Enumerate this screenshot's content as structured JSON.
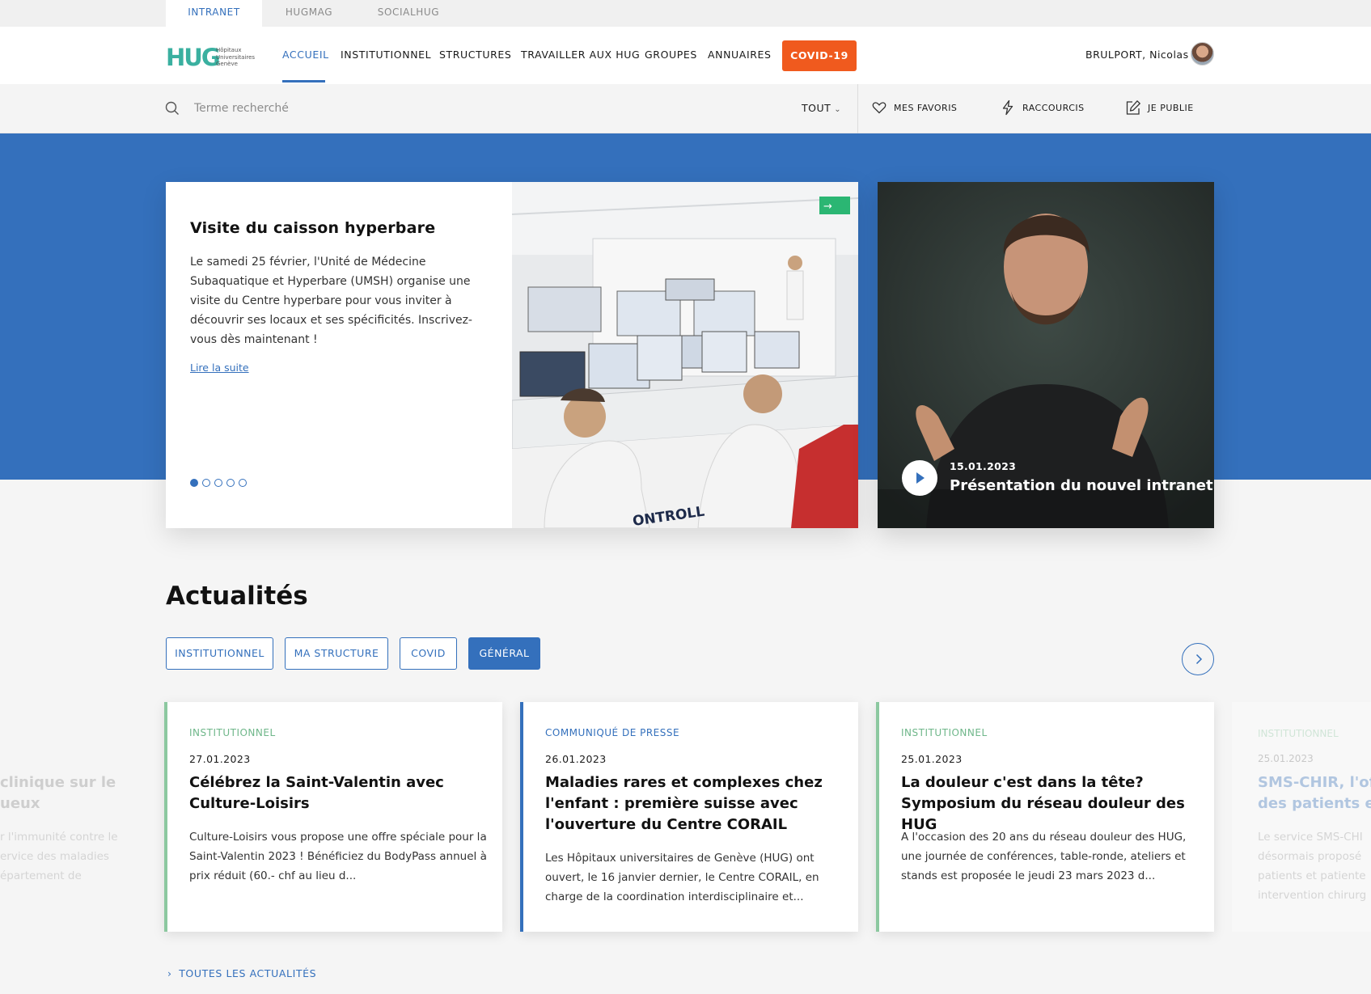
{
  "top_tabs": [
    {
      "label": "INTRANET",
      "active": true
    },
    {
      "label": "HUGMAG",
      "active": false
    },
    {
      "label": "SOCIALHUG",
      "active": false
    }
  ],
  "logo": {
    "mark": "HUG",
    "line1": "Hôpitaux",
    "line2": "Universitaires",
    "line3": "Genève"
  },
  "nav": {
    "items": [
      "ACCUEIL",
      "INSTITUTIONNEL",
      "STRUCTURES",
      "TRAVAILLER AUX HUG",
      "GROUPES",
      "ANNUAIRES"
    ],
    "active": "ACCUEIL",
    "covid_button": "COVID-19"
  },
  "user": {
    "name": "BRULPORT, Nicolas"
  },
  "search": {
    "placeholder": "Terme recherché",
    "scope": "TOUT",
    "quick_links": [
      "MES FAVORIS",
      "RACCOURCIS",
      "JE PUBLIE"
    ]
  },
  "featured": {
    "title": "Visite du caisson hyperbare",
    "text": "Le samedi 25 février, l'Unité de Médecine Subaquatique et Hyperbare (UMSH) organise une visite du Centre hyperbare pour vous inviter à découvrir ses locaux et ses spécificités. Inscrivez-vous dès maintenant !",
    "link": "Lire la suite",
    "slides_total": 5,
    "slide_active": 1,
    "image_text": "ONTROLL"
  },
  "video": {
    "date": "15.01.2023",
    "title": "Présentation du nouvel intranet"
  },
  "news": {
    "title": "Actualités",
    "filters": [
      {
        "label": "INSTITUTIONNEL",
        "active": false
      },
      {
        "label": "MA STRUCTURE",
        "active": false
      },
      {
        "label": "COVID",
        "active": false
      },
      {
        "label": "GÉNÉRAL",
        "active": true
      }
    ],
    "cards": [
      {
        "category": "INSTITUTIONNEL",
        "date": "27.01.2023",
        "title": "Célébrez la Saint-Valentin avec Culture-Loisirs",
        "excerpt": "Culture-Loisirs vous propose une offre spéciale pour la Saint-Valentin 2023 ! Bénéficiez du BodyPass annuel à prix réduit (60.- chf au lieu d...",
        "accent": "#8cc8a0"
      },
      {
        "category": "COMMUNIQUÉ DE PRESSE",
        "date": "26.01.2023",
        "title": "Maladies rares et complexes chez l'enfant : première suisse avec l'ouverture du Centre CORAIL",
        "excerpt": "Les Hôpitaux universitaires de Genève (HUG) ont ouvert, le 16 janvier dernier, le Centre CORAIL, en charge de la coordination interdisciplinaire et...",
        "accent": "#3470bc"
      },
      {
        "category": "INSTITUTIONNEL",
        "date": "25.01.2023",
        "title": "La douleur c'est dans la tête? Symposium du réseau douleur des HUG",
        "excerpt": "A l'occasion des 20 ans du réseau douleur des HUG, une journée de conférences, table-ronde, ateliers et stands est proposée le jeudi 23 mars 2023 d...",
        "accent": "#8cc8a0"
      }
    ],
    "ghost_left": {
      "title1": "clinique sur le",
      "title2": "ueux",
      "line1": "r l'immunité contre le",
      "line2": "ervice des maladies",
      "line3": "épartement de"
    },
    "ghost_right": {
      "category": "INSTITUTIONNEL",
      "date": "25.01.2023",
      "title1": "SMS-CHIR, l'off",
      "title2": "des patients et",
      "line1": "Le service SMS-CHI",
      "line2": "désormais proposé",
      "line3": "patients et patiente",
      "line4": "intervention chirurg"
    },
    "all_link": "TOUTES LES ACTUALITÉS"
  },
  "colors": {
    "brand_blue": "#3470bc",
    "covid_orange": "#f05a1e",
    "institutional_green": "#8cc8a0"
  }
}
